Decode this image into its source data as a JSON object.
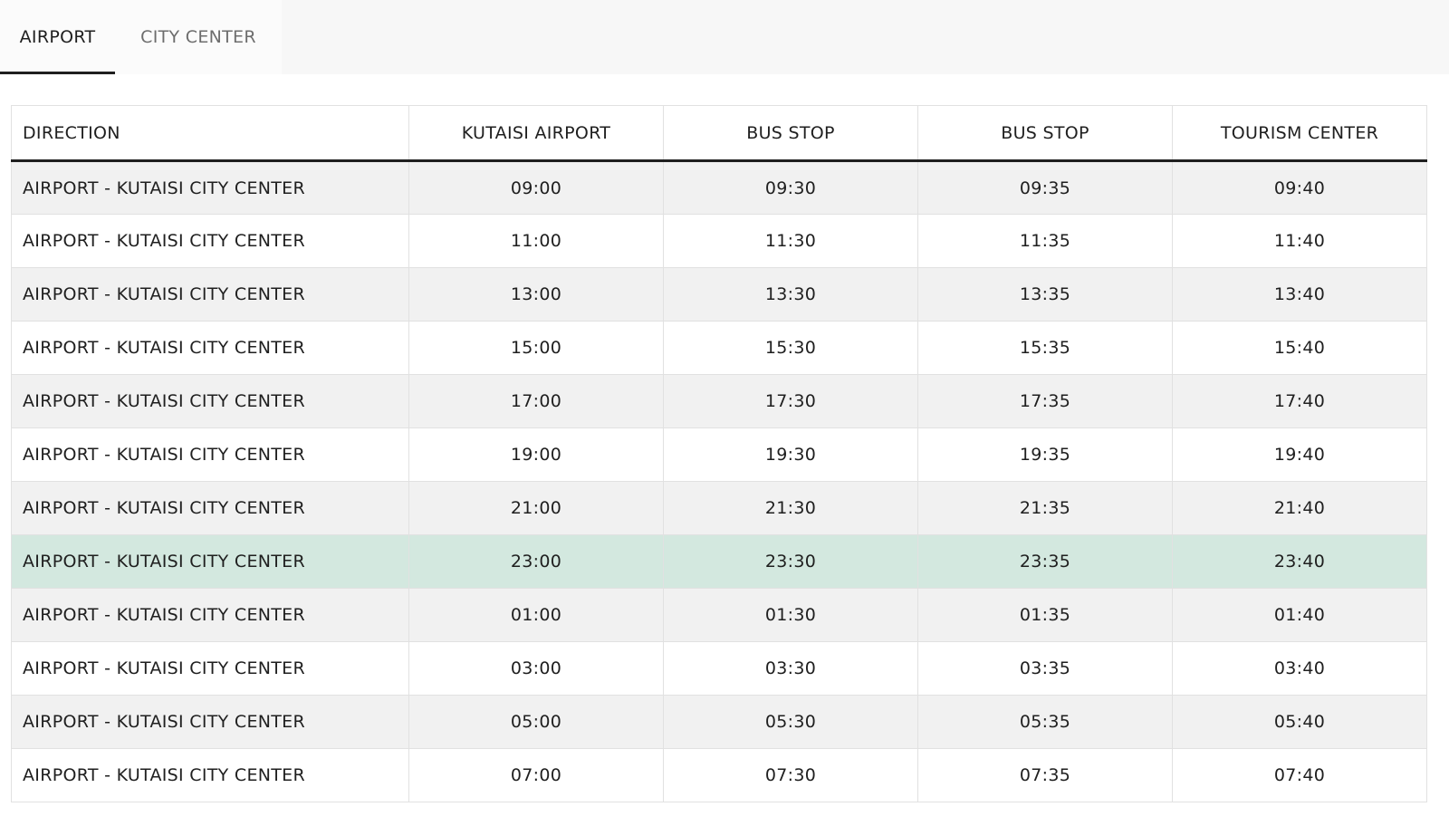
{
  "tabs": [
    {
      "label": "AIRPORT",
      "active": true
    },
    {
      "label": "CITY CENTER",
      "active": false
    }
  ],
  "table": {
    "headers": [
      "DIRECTION",
      "KUTAISI AIRPORT",
      "BUS STOP",
      "BUS STOP",
      "TOURISM CENTER"
    ],
    "highlight_row_index": 7,
    "highlight_color": "#d3e8df",
    "rows": [
      [
        "AIRPORT - KUTAISI CITY CENTER",
        "09:00",
        "09:30",
        "09:35",
        "09:40"
      ],
      [
        "AIRPORT - KUTAISI CITY CENTER",
        "11:00",
        "11:30",
        "11:35",
        "11:40"
      ],
      [
        "AIRPORT - KUTAISI CITY CENTER",
        "13:00",
        "13:30",
        "13:35",
        "13:40"
      ],
      [
        "AIRPORT - KUTAISI CITY CENTER",
        "15:00",
        "15:30",
        "15:35",
        "15:40"
      ],
      [
        "AIRPORT - KUTAISI CITY CENTER",
        "17:00",
        "17:30",
        "17:35",
        "17:40"
      ],
      [
        "AIRPORT - KUTAISI CITY CENTER",
        "19:00",
        "19:30",
        "19:35",
        "19:40"
      ],
      [
        "AIRPORT - KUTAISI CITY CENTER",
        "21:00",
        "21:30",
        "21:35",
        "21:40"
      ],
      [
        "AIRPORT - KUTAISI CITY CENTER",
        "23:00",
        "23:30",
        "23:35",
        "23:40"
      ],
      [
        "AIRPORT - KUTAISI CITY CENTER",
        "01:00",
        "01:30",
        "01:35",
        "01:40"
      ],
      [
        "AIRPORT - KUTAISI CITY CENTER",
        "03:00",
        "03:30",
        "03:35",
        "03:40"
      ],
      [
        "AIRPORT - KUTAISI CITY CENTER",
        "05:00",
        "05:30",
        "05:35",
        "05:40"
      ],
      [
        "AIRPORT - KUTAISI CITY CENTER",
        "07:00",
        "07:30",
        "07:35",
        "07:40"
      ]
    ]
  }
}
